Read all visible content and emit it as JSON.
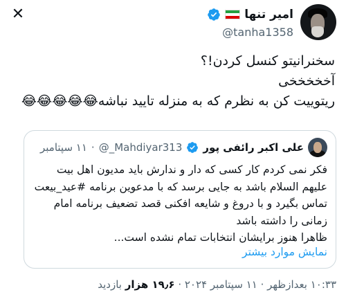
{
  "close_icon": "close-icon",
  "author": {
    "display_name": "امیر تنها",
    "handle": "@tanha1358",
    "flag": "iran-flag-icon",
    "verified": true
  },
  "tweet": {
    "lines": [
      "سخنرانیتو کنسل کردن!؟",
      "آخخخخخی",
      "ریتوییت کن به نظرم که به منزله تایید نباشه😂😂😂😂😂"
    ]
  },
  "quote": {
    "display_name": "علی اکبر رائفی پور",
    "handle": "@_Mahdiyar313",
    "dot": "·",
    "date": "۱۱ سپتامبر",
    "verified": true,
    "lines": [
      "فکر نمی کردم کار کسی که دار و ندارش باید مدیون اهل بیت",
      "علیهم السلام باشد به جایی برسد که با مدعوین برنامه #عید_بیعت",
      "تماس بگیرد و با دروغ و شایعه افکنی قصد تضعیف برنامه امام",
      "زمانی  را داشته باشد",
      "ظاهرا هنوز برایشان انتخابات تمام نشده است..."
    ],
    "show_more": "نمایش موارد بیشتر"
  },
  "meta": {
    "time_date": "۱۰:۳۳ بعدازظهر · ۱۱ سپتامبر ۲۰۲۴ · ",
    "views_count": "۱۹٫۶ هزار",
    "views_label": " بازدید"
  },
  "colors": {
    "verified": "#1d9bf0",
    "link": "#1d9bf0",
    "muted": "#536471",
    "border": "#cfd9de"
  }
}
